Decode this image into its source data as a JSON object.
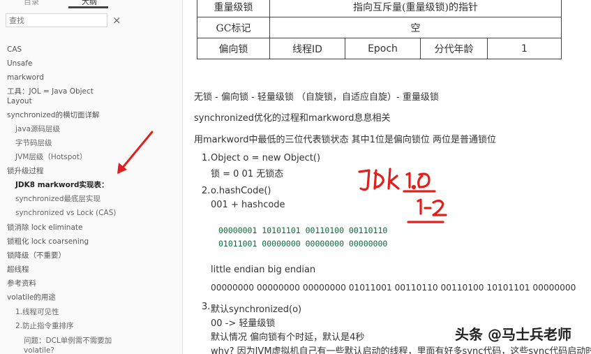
{
  "sidebar": {
    "tabs": [
      "目录",
      "大纲"
    ],
    "search_placeholder": "查找",
    "clear_icon": "×",
    "items": [
      {
        "label": "CAS"
      },
      {
        "label": "Unsafe"
      },
      {
        "label": "markword"
      },
      {
        "label": "工具：JOL = Java Object"
      },
      {
        "label": "Layout"
      },
      {
        "label": "synchronized的横切面详解"
      },
      {
        "label": "java源码层级"
      },
      {
        "label": "字节码层级"
      },
      {
        "label": "JVM层级（Hotspot）"
      },
      {
        "label": "锁升级过程"
      },
      {
        "label": "JDK8 markword实现表："
      },
      {
        "label": "synchronized最底层实现"
      },
      {
        "label": "synchronized vs Lock (CAS)"
      },
      {
        "label": "锁消除 lock eliminate"
      },
      {
        "label": "锁粗化 lock coarsening"
      },
      {
        "label": "锁降级（不重要）"
      },
      {
        "label": "超线程"
      },
      {
        "label": "参考资料"
      },
      {
        "label": "volatile的用途"
      },
      {
        "label": "1.线程可见性"
      },
      {
        "label": "2.防止指令重排序"
      },
      {
        "label": "问题：DCL单例需不需要加"
      },
      {
        "label": "volatile?"
      }
    ]
  },
  "table": {
    "row1": {
      "label": "重量级锁",
      "value": "指向互斥量(重量级锁)的指针"
    },
    "row2": {
      "label": "GC标记",
      "value": "空"
    },
    "row3": {
      "label": "偏向锁",
      "c1": "线程ID",
      "c2": "Epoch",
      "c3": "分代年龄",
      "c4": "1"
    }
  },
  "content": {
    "p1": "无锁 - 偏向锁 - 轻量级锁 （自旋锁，自适应自旋）- 重量级锁",
    "p2": "synchronized优化的过程和markword息息相关",
    "p3": "用markword中最低的三位代表锁状态 其中1位是偏向锁位 两位是普通锁位",
    "n1": "1.",
    "l1a": "Object o = new Object()",
    "l1b": "锁 = 0 01 无锁态",
    "n2": "2.",
    "l2a": "o.hashCode()",
    "l2b": "001 + hashcode",
    "code1": "00000001  10101101  00110100  00110110",
    "code2": "01011001  00000000  00000000  00000000",
    "endian": "little endian big endian",
    "bits": "00000000 00000000 00000000 01011001 00110110 00110100 10101101 00000000",
    "n3": "3.",
    "l3a": "默认synchronized(o)",
    "l3b": "00 -> 轻量级锁",
    "l3c": "默认情况 偏向锁有个时延，默认是4秒",
    "l3d": "why? 因为JVM虚拟机自己有一些默认启动的线程，里面有好多sync代码，这些sync代码启动时就"
  },
  "watermark": "头条 @马士兵老师",
  "annotation_color": "#e0201c"
}
